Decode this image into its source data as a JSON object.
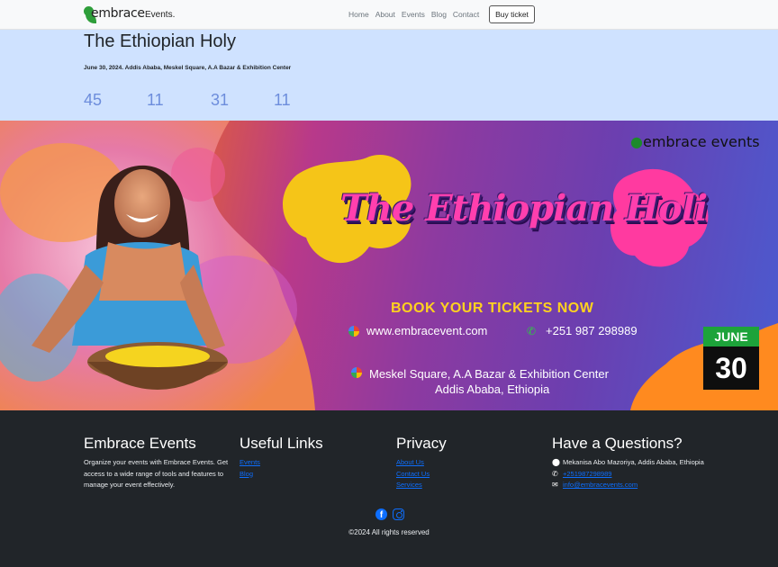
{
  "navbar": {
    "brand_word": "embrace",
    "brand_suffix": "Events.",
    "links": [
      "Home",
      "About",
      "Events",
      "Blog",
      "Contact"
    ],
    "buy_ticket": "Buy ticket"
  },
  "hero": {
    "title": "The Ethiopian Holy",
    "subtitle": "June 30, 2024. Addis Ababa, Meskel Square, A.A Bazar & Exhibition Center",
    "countdown": [
      "45",
      "11",
      "31",
      "11"
    ]
  },
  "banner": {
    "logo": "embrace events",
    "headline": "The Ethiopian Holi",
    "cta": "BOOK YOUR TICKETS NOW",
    "website": "www.embracevent.com",
    "phone": "+251 987 298989",
    "address_line1": "Meskel Square, A.A Bazar & Exhibition Center",
    "address_line2": "Addis Ababa, Ethiopia",
    "date_month": "JUNE",
    "date_day": "30",
    "colors": {
      "month_bg": "#1da33a",
      "day_bg": "#0e0e0e",
      "cta": "#ffd21f",
      "headline": "#ff3fae"
    }
  },
  "footer": {
    "about": {
      "title": "Embrace Events",
      "text": "Organize your events with Embrace Events. Get access to a wide range of tools and features to manage your event effectively."
    },
    "useful_links": {
      "title": "Useful Links",
      "items": [
        "Events",
        "Blog"
      ]
    },
    "privacy": {
      "title": "Privacy",
      "items": [
        "About Us",
        "Contact Us",
        "Services"
      ]
    },
    "contact": {
      "title": "Have a Questions?",
      "address": "Mekanisa Abo Mazoriya, Addis Ababa, Ethiopia",
      "phone": "+251987298989",
      "email": "info@embracevents.com"
    },
    "copyright": "©2024 All rights reserved"
  }
}
